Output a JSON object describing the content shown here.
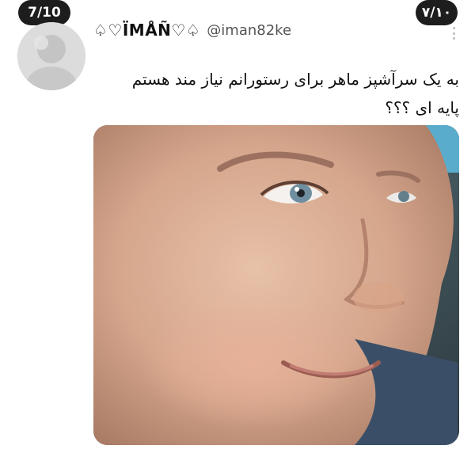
{
  "overlay": {
    "counter_left": "7/10",
    "counter_right": "۷/۱۰"
  },
  "tweet": {
    "display_name": "♤♡ÏMÅÑ♡♤",
    "handle": "@iman82ke",
    "text_line_1": "به یک سرآشپز ماهر برای رستورانم نیاز مند هستم",
    "text_line_2": "پایه ای ؟؟؟"
  },
  "icons": {
    "more": "more-options-icon"
  }
}
